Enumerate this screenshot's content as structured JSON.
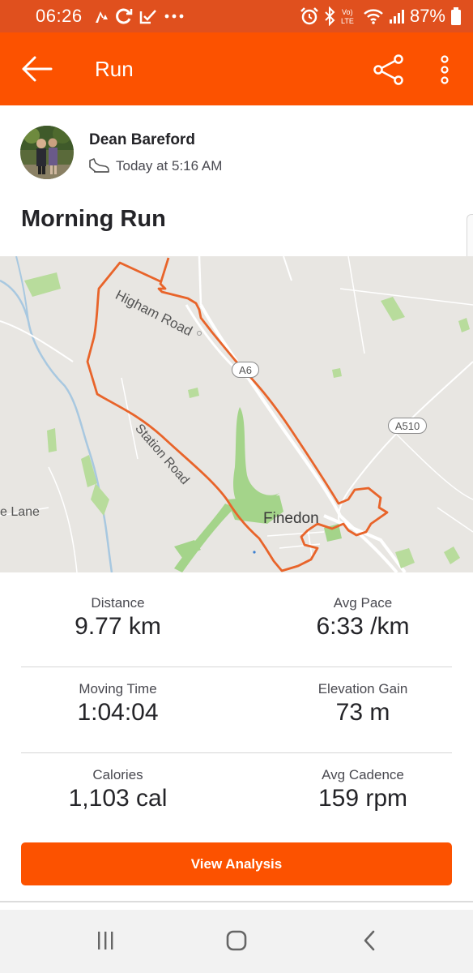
{
  "status_bar": {
    "time": "06:26",
    "battery": "87%",
    "icons_left": [
      "strava-notification-icon",
      "sync-icon",
      "tasks-icon",
      "more-notifications-icon"
    ],
    "icons_right": [
      "alarm-icon",
      "bluetooth-icon",
      "volte-icon",
      "wifi-icon",
      "signal-icon",
      "battery-icon"
    ]
  },
  "app_bar": {
    "title": "Run",
    "back_icon": "arrow-left-icon",
    "share_icon": "share-icon",
    "more_icon": "more-vertical-icon"
  },
  "athlete": {
    "name": "Dean Bareford",
    "activity_icon": "run-shoe-icon",
    "time": "Today at 5:16 AM"
  },
  "activity": {
    "title": "Morning Run"
  },
  "map": {
    "labels": {
      "higham_road": "Higham Road",
      "station_road": "Station Road",
      "lane": "e Lane",
      "town": "Finedon"
    },
    "road_badges": {
      "a6": "A6",
      "a510": "A510"
    },
    "route_color": "#e8642a"
  },
  "stats": [
    {
      "left": {
        "label": "Distance",
        "value": "9.77 km"
      },
      "right": {
        "label": "Avg Pace",
        "value": "6:33 /km"
      }
    },
    {
      "left": {
        "label": "Moving Time",
        "value": "1:04:04"
      },
      "right": {
        "label": "Elevation Gain",
        "value": "73 m"
      }
    },
    {
      "left": {
        "label": "Calories",
        "value": "1,103 cal"
      },
      "right": {
        "label": "Avg Cadence",
        "value": "159 rpm"
      }
    }
  ],
  "actions": {
    "view_analysis": "View Analysis"
  },
  "nav_bar": {
    "icons": [
      "recent-apps-icon",
      "home-icon",
      "back-icon"
    ]
  },
  "colors": {
    "accent": "#fc5200",
    "status_bar": "#e0501e",
    "text_primary": "#242428",
    "text_secondary": "#494950"
  }
}
